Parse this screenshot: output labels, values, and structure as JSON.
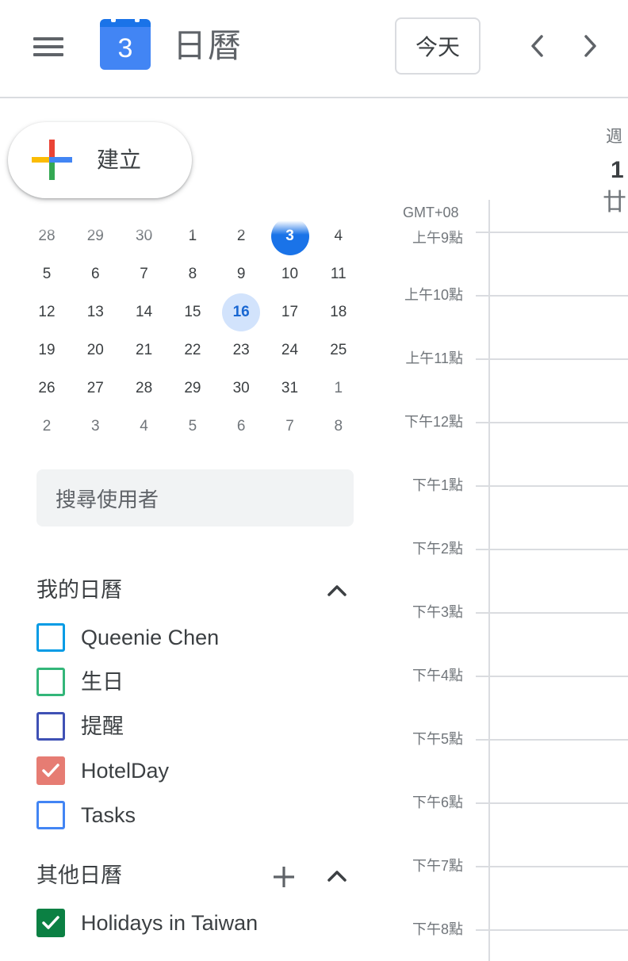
{
  "header": {
    "logo_day": "3",
    "app_title": "日曆",
    "today_label": "今天"
  },
  "create": {
    "label": "建立"
  },
  "mini_calendar": {
    "weeks": [
      [
        {
          "d": "28",
          "dim": true
        },
        {
          "d": "29",
          "dim": true
        },
        {
          "d": "30",
          "dim": true
        },
        {
          "d": "1"
        },
        {
          "d": "2"
        },
        {
          "d": "3",
          "today": true
        },
        {
          "d": "4"
        }
      ],
      [
        {
          "d": "5"
        },
        {
          "d": "6"
        },
        {
          "d": "7"
        },
        {
          "d": "8"
        },
        {
          "d": "9"
        },
        {
          "d": "10"
        },
        {
          "d": "11"
        }
      ],
      [
        {
          "d": "12"
        },
        {
          "d": "13"
        },
        {
          "d": "14"
        },
        {
          "d": "15"
        },
        {
          "d": "16",
          "selected": true
        },
        {
          "d": "17"
        },
        {
          "d": "18"
        }
      ],
      [
        {
          "d": "19"
        },
        {
          "d": "20"
        },
        {
          "d": "21"
        },
        {
          "d": "22"
        },
        {
          "d": "23"
        },
        {
          "d": "24"
        },
        {
          "d": "25"
        }
      ],
      [
        {
          "d": "26"
        },
        {
          "d": "27"
        },
        {
          "d": "28"
        },
        {
          "d": "29"
        },
        {
          "d": "30"
        },
        {
          "d": "31"
        },
        {
          "d": "1",
          "dim": true
        }
      ],
      [
        {
          "d": "2",
          "dim": true
        },
        {
          "d": "3",
          "dim": true
        },
        {
          "d": "4",
          "dim": true
        },
        {
          "d": "5",
          "dim": true
        },
        {
          "d": "6",
          "dim": true
        },
        {
          "d": "7",
          "dim": true
        },
        {
          "d": "8",
          "dim": true
        }
      ]
    ]
  },
  "search": {
    "placeholder": "搜尋使用者"
  },
  "my_calendars": {
    "title": "我的日曆",
    "items": [
      {
        "label": "Queenie Chen",
        "color": "#039be5",
        "checked": false
      },
      {
        "label": "生日",
        "color": "#33b679",
        "checked": false
      },
      {
        "label": "提醒",
        "color": "#3f51b5",
        "checked": false
      },
      {
        "label": "HotelDay",
        "color": "#e67c73",
        "checked": true
      },
      {
        "label": "Tasks",
        "color": "#4285f4",
        "checked": false
      }
    ]
  },
  "other_calendars": {
    "title": "其他日曆",
    "items": [
      {
        "label": "Holidays in Taiwan",
        "color": "#0b8043",
        "checked": true
      }
    ]
  },
  "day_view": {
    "dow_partial": "週",
    "date_partial": "1",
    "lunar_partial": "廿",
    "timezone": "GMT+08",
    "hours": [
      "上午9點",
      "上午10點",
      "上午11點",
      "下午12點",
      "下午1點",
      "下午2點",
      "下午3點",
      "下午4點",
      "下午5點",
      "下午6點",
      "下午7點",
      "下午8點"
    ]
  },
  "colors": {
    "accent": "#1a73e8",
    "selected_bg": "#d2e3fc",
    "grid": "#dadce0"
  }
}
